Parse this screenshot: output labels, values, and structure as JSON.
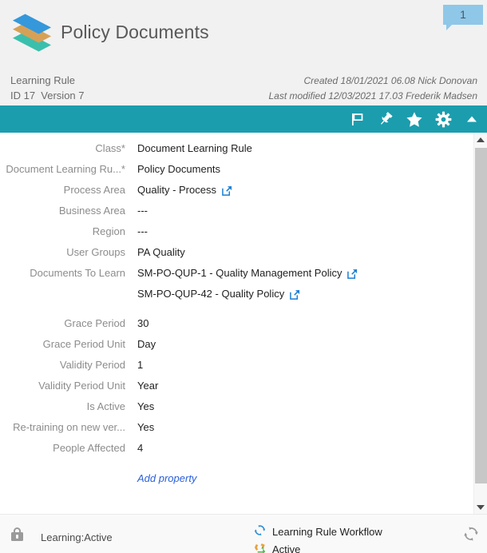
{
  "header": {
    "title": "Policy Documents",
    "badge_count": "1",
    "logo_icon": "stacked-layers-icon",
    "object_type": "Learning Rule",
    "id_version": "ID 17  Version 7",
    "created": "Created 18/01/2021 06.08 Nick Donovan",
    "last_modified": "Last modified 12/03/2021 17.03 Frederik Madsen"
  },
  "toolbar": {
    "icons": [
      {
        "name": "flag-icon",
        "label": "Flag"
      },
      {
        "name": "pin-icon",
        "label": "Pin"
      },
      {
        "name": "star-icon",
        "label": "Favorite"
      },
      {
        "name": "gear-icon",
        "label": "Settings"
      },
      {
        "name": "chevron-up-icon",
        "label": "Collapse"
      }
    ]
  },
  "properties": [
    {
      "label": "Class*",
      "value": "Document Learning Rule",
      "link": false
    },
    {
      "label": "Document Learning Ru...*",
      "value": "Policy Documents",
      "link": false
    },
    {
      "label": "Process Area",
      "value": "Quality - Process",
      "link": true
    },
    {
      "label": "Business Area",
      "value": "---",
      "link": false
    },
    {
      "label": "Region",
      "value": "---",
      "link": false
    },
    {
      "label": "User Groups",
      "value": "PA Quality",
      "link": false
    },
    {
      "label": "Documents To Learn",
      "value": "SM-PO-QUP-1 - Quality Management Policy",
      "link": true
    },
    {
      "label": "",
      "value": "SM-PO-QUP-42 - Quality Policy",
      "link": true
    },
    {
      "label": "Grace Period",
      "value": "30",
      "link": false
    },
    {
      "label": "Grace Period Unit",
      "value": "Day",
      "link": false
    },
    {
      "label": "Validity Period",
      "value": "1",
      "link": false
    },
    {
      "label": "Validity Period Unit",
      "value": "Year",
      "link": false
    },
    {
      "label": "Is Active",
      "value": "Yes",
      "link": false
    },
    {
      "label": "Re-training on new ver...",
      "value": "Yes",
      "link": false
    },
    {
      "label": "People Affected",
      "value": "4",
      "link": false
    }
  ],
  "add_property_label": "Add property",
  "footer": {
    "lock_icon": "lock-icon",
    "state_label": "Learning:Active",
    "workflow_name": "Learning Rule Workflow",
    "workflow_icon": "workflow-refresh-icon",
    "workflow_state": "Active",
    "workflow_state_icon": "state-transition-icon",
    "corner_icon": "refresh-circular-icon"
  },
  "scrollbar": {
    "up_icon": "chevron-up-icon",
    "down_icon": "chevron-down-icon"
  },
  "colors": {
    "toolbar_teal": "#1b9dae",
    "header_bg": "#f1f1f1",
    "badge_blue": "#8fc7e8",
    "link_blue": "#2b5fd9",
    "extlink_blue": "#1b7fd4",
    "label_gray": "#8c8c8c"
  }
}
